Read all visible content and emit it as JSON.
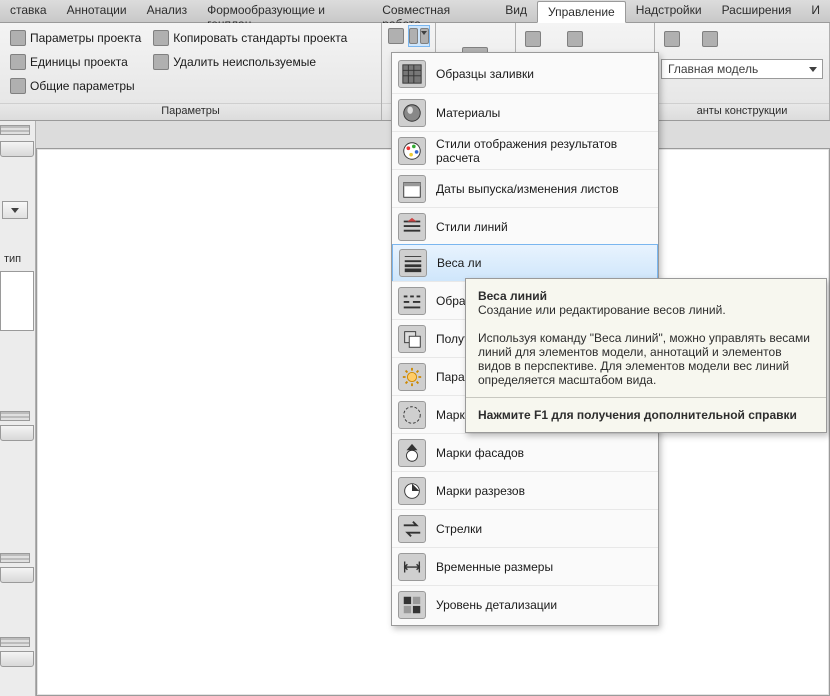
{
  "tabs": {
    "items": [
      {
        "label": "ставка"
      },
      {
        "label": "Аннотации"
      },
      {
        "label": "Анализ"
      },
      {
        "label": "Формообразующие и генплан"
      },
      {
        "label": "Совместная работа"
      },
      {
        "label": "Вид"
      },
      {
        "label": "Управление",
        "active": true
      },
      {
        "label": "Надстройки"
      },
      {
        "label": "Расширения"
      },
      {
        "label": "И"
      }
    ]
  },
  "ribbon": {
    "group_params": {
      "title": "Параметры",
      "btns": [
        "Параметры проекта",
        "Единицы проекта",
        "Общие параметры",
        "Копировать стандарты проекта",
        "Удалить неиспользуемые"
      ]
    },
    "group_variants": {
      "title": "анты конструкции",
      "combo": "Главная модель"
    }
  },
  "leftpanel": {
    "label": "тип"
  },
  "menu": {
    "items": [
      {
        "icon": "hatch-icon",
        "label": "Образцы заливки"
      },
      {
        "icon": "sphere-icon",
        "label": "Материалы"
      },
      {
        "icon": "palette-icon",
        "label": "Стили отображения результатов расчета"
      },
      {
        "icon": "calendar-icon",
        "label": "Даты выпуска/изменения листов"
      },
      {
        "icon": "lines-icon",
        "label": "Стили линий"
      },
      {
        "icon": "weights-icon",
        "label": "Веса ли",
        "hl": true
      },
      {
        "icon": "dashed-icon",
        "label": "Образц"
      },
      {
        "icon": "halftone-icon",
        "label": "Полуто"
      },
      {
        "icon": "sun-icon",
        "label": "Параме"
      },
      {
        "icon": "tag-icon",
        "label": "Марки ф"
      },
      {
        "icon": "elev-icon",
        "label": "Марки фасадов"
      },
      {
        "icon": "section-icon",
        "label": "Марки разрезов"
      },
      {
        "icon": "arrows-icon",
        "label": "Стрелки"
      },
      {
        "icon": "dim-icon",
        "label": "Временные размеры"
      },
      {
        "icon": "detail-icon",
        "label": "Уровень детализации"
      }
    ]
  },
  "tooltip": {
    "title": "Веса линий",
    "line": "Создание или редактирование весов линий.",
    "body": "Используя команду \"Веса линий\", можно управлять весами линий для элементов модели, аннотаций и элементов видов в перспективе. Для элементов модели вес линий определяется масштабом вида.",
    "f1": "Нажмите F1 для получения дополнительной справки"
  }
}
